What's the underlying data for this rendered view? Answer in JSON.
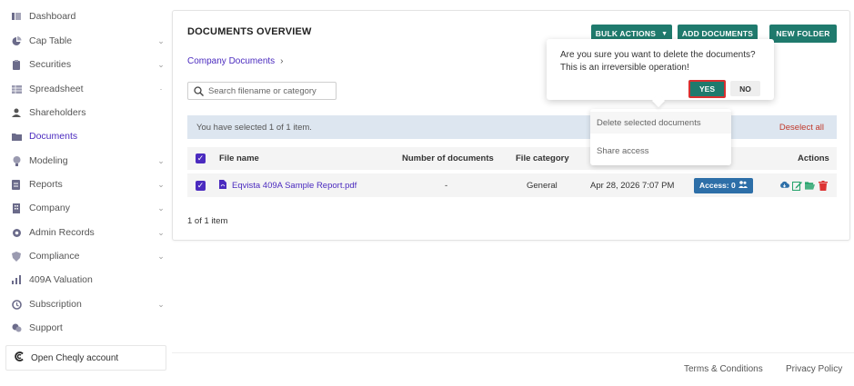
{
  "sidebar": {
    "items": [
      {
        "label": "Dashboard",
        "icon": "dashboard-icon",
        "chevron": false,
        "active": false
      },
      {
        "label": "Cap Table",
        "icon": "pie-chart-icon",
        "chevron": true,
        "active": false
      },
      {
        "label": "Securities",
        "icon": "clipboard-icon",
        "chevron": true,
        "active": false
      },
      {
        "label": "Spreadsheet",
        "icon": "spreadsheet-icon",
        "chevron": true,
        "active": false
      },
      {
        "label": "Shareholders",
        "icon": "user-icon",
        "chevron": false,
        "active": false
      },
      {
        "label": "Documents",
        "icon": "folder-icon",
        "chevron": false,
        "active": true
      },
      {
        "label": "Modeling",
        "icon": "lightbulb-icon",
        "chevron": true,
        "active": false
      },
      {
        "label": "Reports",
        "icon": "report-icon",
        "chevron": true,
        "active": false
      },
      {
        "label": "Company",
        "icon": "building-icon",
        "chevron": true,
        "active": false
      },
      {
        "label": "Admin Records",
        "icon": "admin-icon",
        "chevron": true,
        "active": false
      },
      {
        "label": "Compliance",
        "icon": "shield-icon",
        "chevron": true,
        "active": false
      },
      {
        "label": "409A Valuation",
        "icon": "valuation-icon",
        "chevron": false,
        "active": false
      },
      {
        "label": "Subscription",
        "icon": "subscription-icon",
        "chevron": true,
        "active": false
      },
      {
        "label": "Support",
        "icon": "support-icon",
        "chevron": false,
        "active": false
      }
    ],
    "cheqly_label": "Open Cheqly account"
  },
  "header": {
    "title": "DOCUMENTS OVERVIEW",
    "bulk_actions_label": "BULK ACTIONS",
    "add_documents_label": "ADD DOCUMENTS",
    "new_folder_label": "NEW FOLDER"
  },
  "breadcrumb": {
    "label": "Company Documents"
  },
  "search": {
    "placeholder": "Search filename or category",
    "value": ""
  },
  "selection": {
    "text": "You have selected 1 of 1 item.",
    "deselect_label": "Deselect all"
  },
  "table": {
    "columns": {
      "file_name": "File name",
      "number_of_documents": "Number of documents",
      "file_category": "File category",
      "actions": "Actions"
    },
    "rows": [
      {
        "file_name": "Eqvista 409A Sample Report.pdf",
        "number_of_documents": "-",
        "file_category": "General",
        "date": "Apr 28, 2026 7:07 PM",
        "access": "Access: 0"
      }
    ]
  },
  "pagination": {
    "text": "1 of 1 item"
  },
  "dropdown": {
    "items": [
      "Delete selected documents",
      "Share access"
    ]
  },
  "popconfirm": {
    "message": "Are you sure you want to delete the documents? This is an irreversible operation!",
    "yes_label": "YES",
    "no_label": "NO"
  },
  "footer": {
    "terms": "Terms & Conditions",
    "privacy": "Privacy Policy"
  },
  "colors": {
    "accent": "#4b2bbf",
    "button": "#1f7a6d",
    "danger": "#c0392b",
    "access": "#2d6fa8"
  }
}
